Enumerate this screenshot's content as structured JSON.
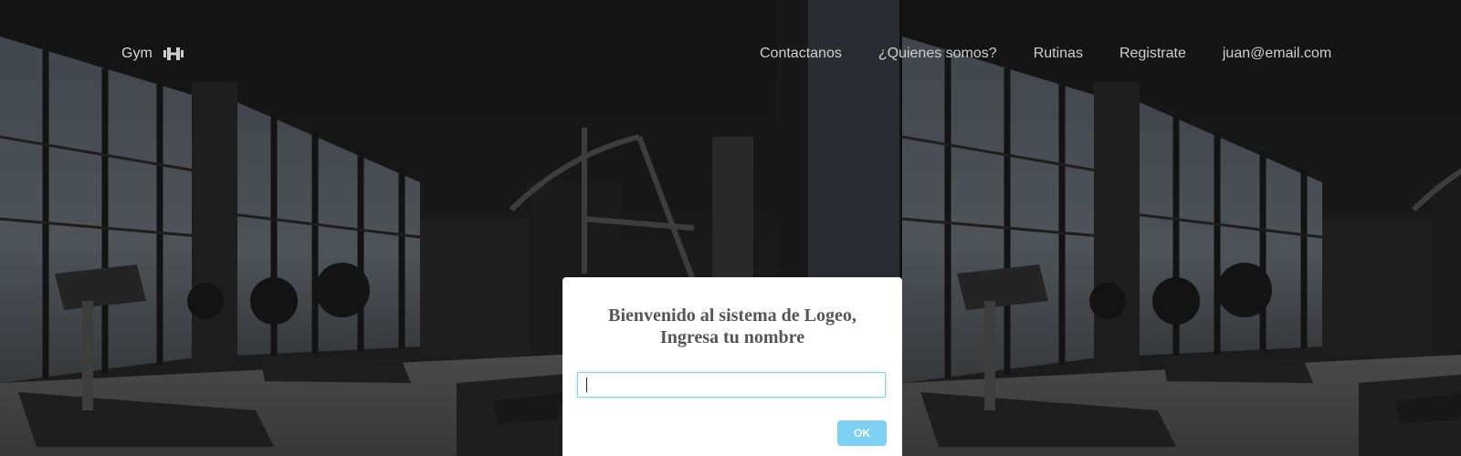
{
  "navbar": {
    "brand_label": "Gym",
    "brand_icon": "dumbbell-icon",
    "links": [
      {
        "label": "Contactanos"
      },
      {
        "label": "¿Quienes somos?"
      },
      {
        "label": "Rutinas"
      },
      {
        "label": "Registrate"
      },
      {
        "label": "juan@email.com"
      }
    ]
  },
  "dialog": {
    "title_line1": "Bienvenido al sistema de Logeo,",
    "title_line2": "Ingresa tu nombre",
    "input_value": "",
    "ok_label": "OK"
  },
  "colors": {
    "ok_button": "#7ecff4",
    "input_border": "#8ed0ee",
    "title_text": "#555555",
    "nav_text": "#cfcfcf"
  }
}
